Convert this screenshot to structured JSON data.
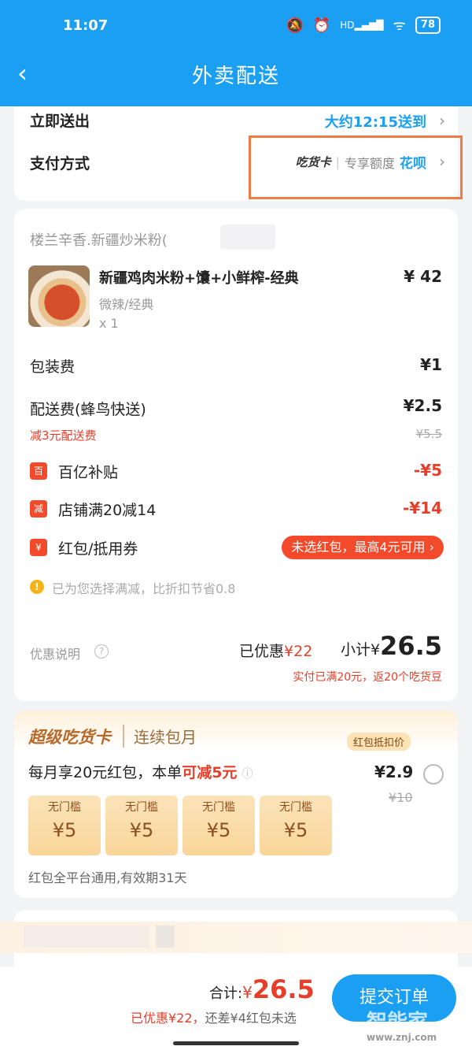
{
  "status_bar": {
    "time": "11:07",
    "hd": "HD",
    "battery": "78"
  },
  "nav": {
    "back": "‹",
    "title": "外卖配送"
  },
  "delivery": {
    "label": "立即送出",
    "time": "大约12:15送到"
  },
  "payment": {
    "label": "支付方式",
    "card": "吃货卡",
    "quota": "专享额度",
    "method": "花呗"
  },
  "order": {
    "shop": "楼兰辛香.新疆炒米粉(",
    "item": {
      "name": "新疆鸡肉米粉+馕+小鲜榨-经典",
      "spec": "微辣/经典",
      "qty": "x 1",
      "price": "¥ 42"
    },
    "packing": {
      "label": "包装费",
      "value": "¥1"
    },
    "delivery_fee": {
      "label": "配送费(蜂鸟快送)",
      "value": "¥2.5",
      "discount_note": "减3元配送费",
      "original": "¥5.5"
    },
    "subsidy": {
      "badge": "百",
      "label": "百亿补贴",
      "value": "-¥5"
    },
    "shop_discount": {
      "badge": "减",
      "label": "店铺满20减14",
      "value": "-¥14"
    },
    "red_packet": {
      "badge": "¥",
      "label": "红包/抵用券",
      "button": "未选红包，最高4元可用 ›"
    },
    "tip": "已为您选择满减，比折扣节省0.8",
    "explain": "优惠说明",
    "saved_prefix": "已优惠",
    "saved_value": "¥22",
    "subtotal_prefix": "小计¥",
    "subtotal_value": "26.5",
    "subtotal_note": "实付已满20元，返20个吃货豆"
  },
  "member": {
    "title": "超级吃货卡",
    "subtitle": "连续包月",
    "tag": "红包抵扣价",
    "desc_prefix": "每月享20元红包，本单",
    "desc_highlight": "可减5元",
    "price": "¥2.9",
    "original": "¥10",
    "coupons": [
      {
        "label": "无门槛",
        "amount": "¥5"
      },
      {
        "label": "无门槛",
        "amount": "¥5"
      },
      {
        "label": "无门槛",
        "amount": "¥5"
      },
      {
        "label": "无门槛",
        "amount": "¥5"
      }
    ],
    "note": "红包全平台通用,有效期31天"
  },
  "bottom": {
    "total_label": "合计:",
    "total_currency": "¥",
    "total_value": "26.5",
    "saved": "已优惠¥22，",
    "remaining": "还差¥4红包未选",
    "submit": "提交订单"
  },
  "watermark": {
    "text": "智能家",
    "site": "www.znj.com"
  }
}
